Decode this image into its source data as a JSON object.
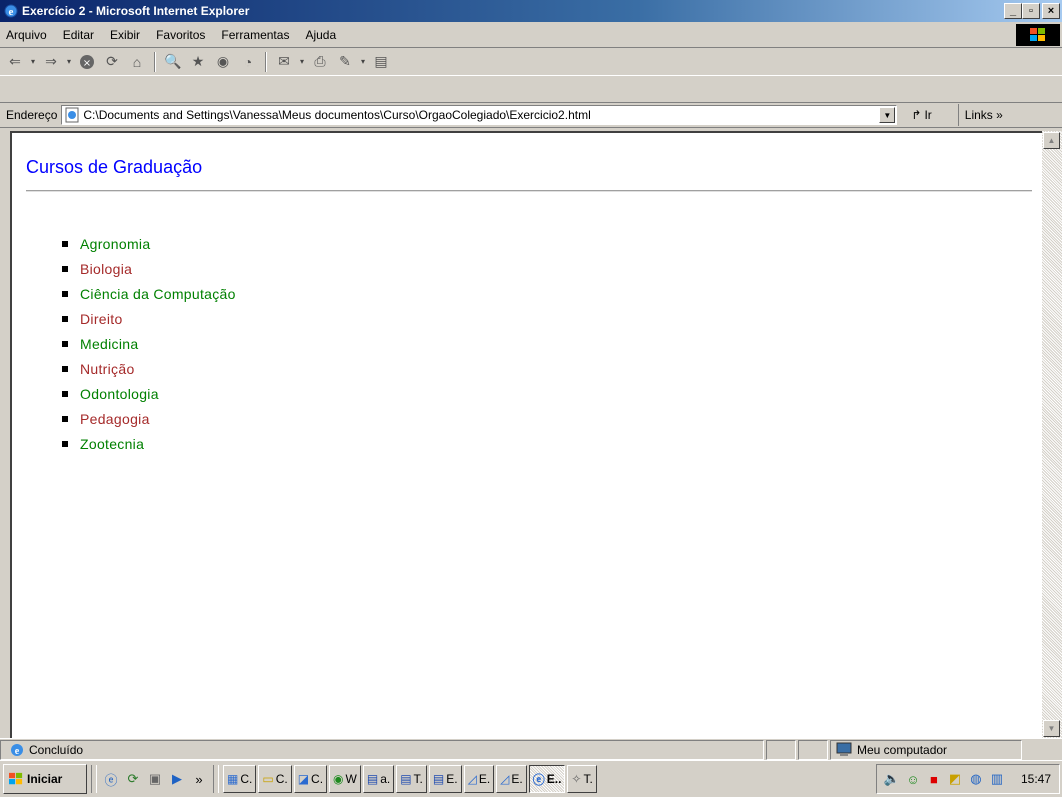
{
  "window": {
    "title": "Exercício 2 - Microsoft Internet Explorer",
    "minimize": "_",
    "maximize": "▫",
    "close": "×"
  },
  "menu": [
    "Arquivo",
    "Editar",
    "Exibir",
    "Favoritos",
    "Ferramentas",
    "Ajuda"
  ],
  "toolbar": {
    "icons": [
      "back-icon",
      "forward-icon",
      "stop-icon",
      "refresh-icon",
      "home-icon",
      "search-icon",
      "favorites-icon",
      "media-icon",
      "history-icon",
      "mail-icon",
      "print-icon",
      "edit-icon",
      "discuss-icon"
    ]
  },
  "address": {
    "label": "Endereço",
    "url": "C:\\Documents and Settings\\Vanessa\\Meus documentos\\Curso\\OrgaoColegiado\\Exercicio2.html",
    "go_label": "Ir",
    "links_label": "Links »"
  },
  "page": {
    "title": "Cursos de Graduação",
    "courses": [
      {
        "name": "Agronomia",
        "color": "#008000"
      },
      {
        "name": "Biologia",
        "color": "#a52a2a"
      },
      {
        "name": "Ciência da Computação",
        "color": "#008000"
      },
      {
        "name": "Direito",
        "color": "#a52a2a"
      },
      {
        "name": "Medicina",
        "color": "#008000"
      },
      {
        "name": "Nutrição",
        "color": "#a52a2a"
      },
      {
        "name": "Odontologia",
        "color": "#008000"
      },
      {
        "name": "Pedagogia",
        "color": "#a52a2a"
      },
      {
        "name": "Zootecnia",
        "color": "#008000"
      }
    ]
  },
  "status": {
    "text": "Concluído",
    "zone": "Meu computador"
  },
  "taskbar": {
    "start_label": "Iniciar",
    "chevron": "»",
    "tasks": [
      "C.",
      "C.",
      "C.",
      "W",
      "a.",
      "T.",
      "E.",
      "E.",
      "E.",
      "E..",
      "T."
    ],
    "clock": "15:47"
  }
}
